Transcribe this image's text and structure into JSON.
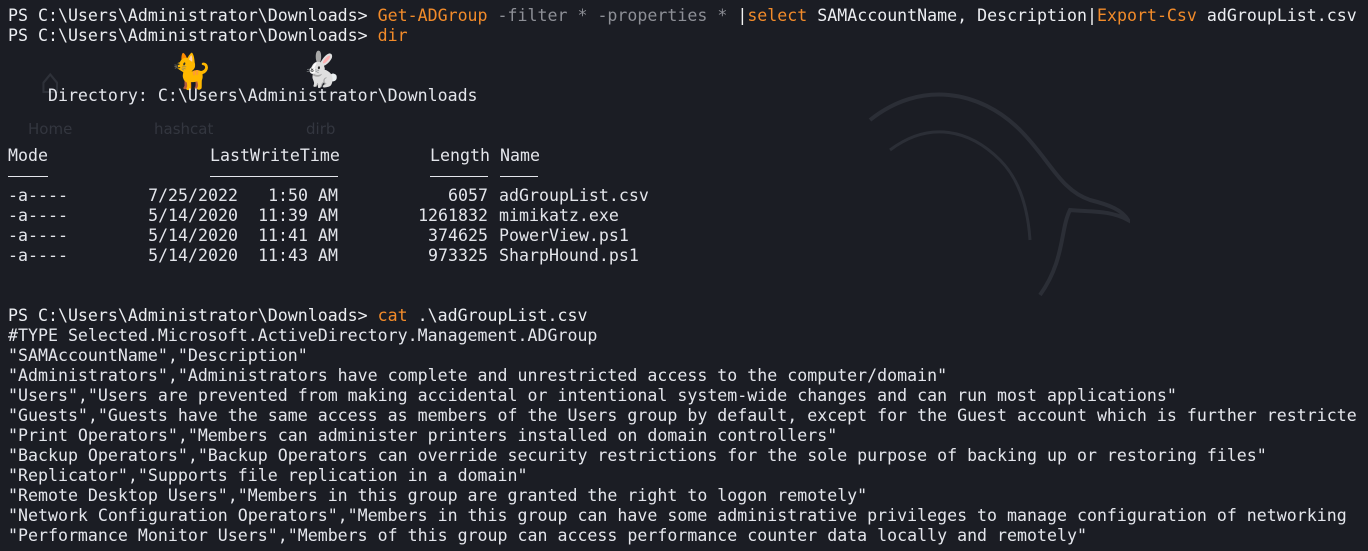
{
  "prompt": "PS C:\\Users\\Administrator\\Downloads> ",
  "commands": {
    "first": {
      "cmdlet": "Get-ADGroup",
      "args": " -filter * -properties * ",
      "pipe1": "|",
      "select": "select",
      "select_args": " SAMAccountName, Description",
      "pipe2": "|",
      "export": "Export-Csv",
      "export_arg": " adGroupList.csv"
    },
    "second": {
      "cmdlet": "dir"
    },
    "third": {
      "cmdlet": "cat",
      "arg": " .\\adGroupList.csv"
    }
  },
  "desktop_background": {
    "labels": [
      "Home",
      "hashcat",
      "dirb"
    ],
    "icons": [
      "home-icon",
      "cat-icon",
      "rabbit-icon",
      "kali-dragon-logo"
    ]
  },
  "directory": {
    "heading": "    Directory: C:\\Users\\Administrator\\Downloads",
    "columns": [
      "Mode",
      "LastWriteTime",
      "Length",
      "Name"
    ],
    "rows": [
      {
        "mode": "-a----",
        "date": "7/25/2022",
        "time": "1:50 AM",
        "length": "6057",
        "name": "adGroupList.csv"
      },
      {
        "mode": "-a----",
        "date": "5/14/2020",
        "time": "11:39 AM",
        "length": "1261832",
        "name": "mimikatz.exe"
      },
      {
        "mode": "-a----",
        "date": "5/14/2020",
        "time": "11:41 AM",
        "length": "374625",
        "name": "PowerView.ps1"
      },
      {
        "mode": "-a----",
        "date": "5/14/2020",
        "time": "11:43 AM",
        "length": "973325",
        "name": "SharpHound.ps1"
      }
    ]
  },
  "csv_output": [
    "#TYPE Selected.Microsoft.ActiveDirectory.Management.ADGroup",
    "\"SAMAccountName\",\"Description\"",
    "\"Administrators\",\"Administrators have complete and unrestricted access to the computer/domain\"",
    "\"Users\",\"Users are prevented from making accidental or intentional system-wide changes and can run most applications\"",
    "\"Guests\",\"Guests have the same access as members of the Users group by default, except for the Guest account which is further restricte",
    "\"Print Operators\",\"Members can administer printers installed on domain controllers\"",
    "\"Backup Operators\",\"Backup Operators can override security restrictions for the sole purpose of backing up or restoring files\"",
    "\"Replicator\",\"Supports file replication in a domain\"",
    "\"Remote Desktop Users\",\"Members in this group are granted the right to logon remotely\"",
    "\"Network Configuration Operators\",\"Members in this group can have some administrative privileges to manage configuration of networking",
    "\"Performance Monitor Users\",\"Members of this group can access performance counter data locally and remotely\""
  ],
  "colors": {
    "background": "#1b1d24",
    "text": "#e4e6ec",
    "cmdlet": "#f28b2a",
    "parameter": "#8d8f96"
  }
}
